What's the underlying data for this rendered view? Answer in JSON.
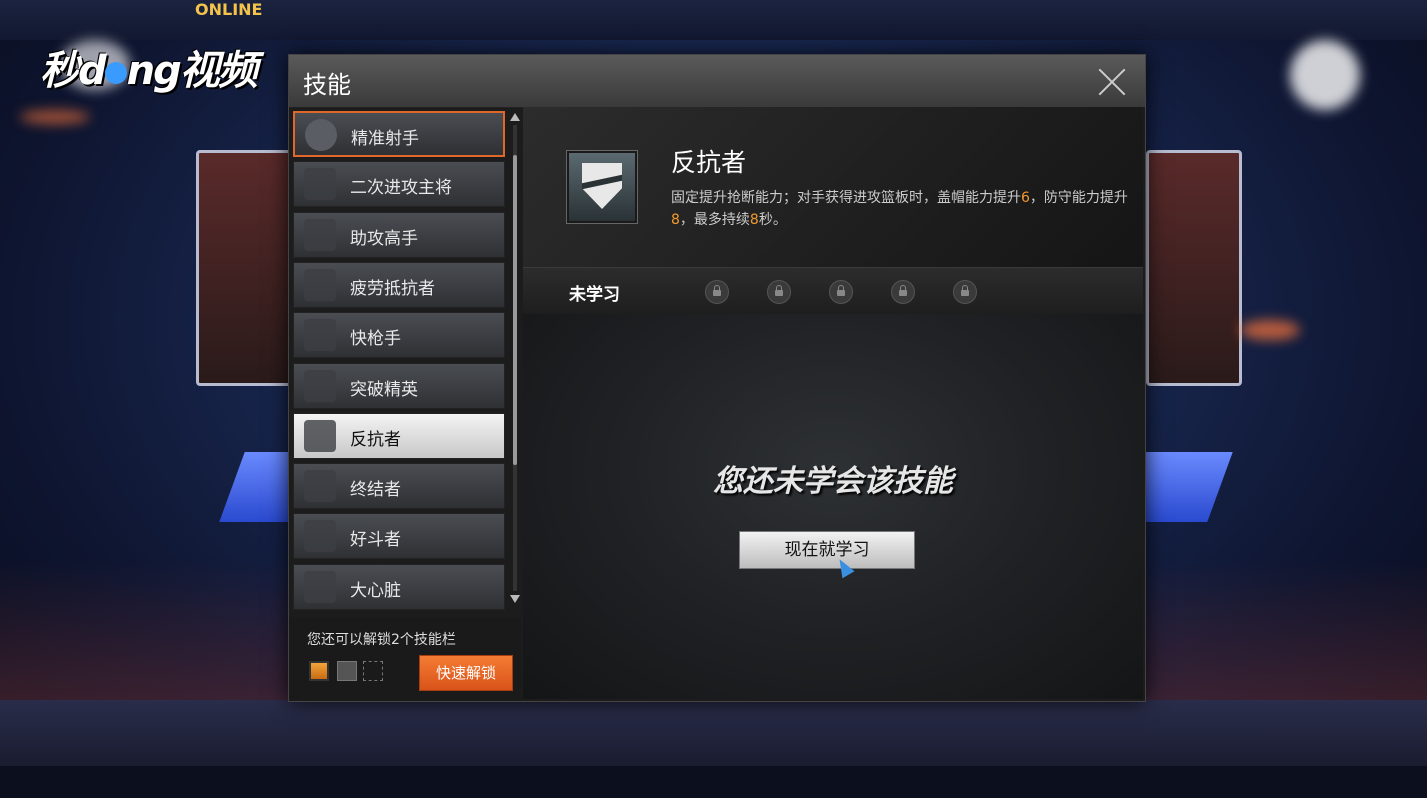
{
  "watermark": {
    "text_left": "秒",
    "text_mid": "ng",
    "text_right": "视频"
  },
  "game_logo": "ONLINE",
  "dialog": {
    "title": "技能",
    "skills": [
      {
        "label": "精准射手",
        "state": "hover"
      },
      {
        "label": "二次进攻主将",
        "state": "normal"
      },
      {
        "label": "助攻高手",
        "state": "normal"
      },
      {
        "label": "疲劳抵抗者",
        "state": "normal"
      },
      {
        "label": "快枪手",
        "state": "normal"
      },
      {
        "label": "突破精英",
        "state": "normal"
      },
      {
        "label": "反抗者",
        "state": "active"
      },
      {
        "label": "终结者",
        "state": "normal"
      },
      {
        "label": "好斗者",
        "state": "normal"
      },
      {
        "label": "大心脏",
        "state": "normal"
      }
    ],
    "unlock": {
      "text": "您还可以解锁2个技能栏",
      "button_label": "快速解锁"
    },
    "detail": {
      "name": "反抗者",
      "desc_1": "固定提升抢断能力；对手获得进攻篮板时，盖帽能力提升",
      "val_1": "6",
      "desc_2": "，防守能力提升",
      "val_2": "8",
      "desc_3": "，最多持续",
      "val_3": "8",
      "desc_4": "秒。",
      "status_label": "未学习",
      "not_learned_text": "您还未学会该技能",
      "learn_button": "现在就学习"
    }
  },
  "colors": {
    "accent": "#f47c33",
    "highlight": "#f39a2e"
  }
}
